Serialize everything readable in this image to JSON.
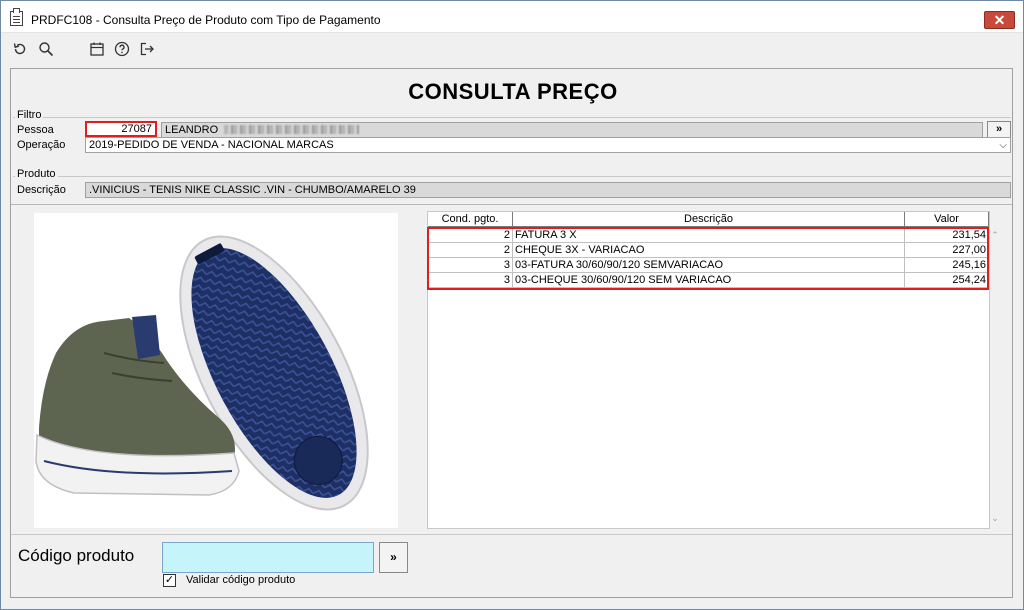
{
  "window": {
    "title": "PRDFC108 - Consulta Preço de Produto com Tipo de Pagamento",
    "close_label": "✕"
  },
  "toolbar": {
    "icons": [
      "refresh-icon",
      "search-icon",
      "calendar-icon",
      "help-icon",
      "exit-icon"
    ]
  },
  "page": {
    "title": "CONSULTA PREÇO"
  },
  "filtro": {
    "group_label": "Filtro",
    "pessoa_label": "Pessoa",
    "pessoa_code": "27087",
    "pessoa_name": "LEANDRO",
    "pessoa_btn": "»",
    "operacao_label": "Operação",
    "operacao_value": "2019-PEDIDO DE VENDA - NACIONAL MARCAS"
  },
  "produto": {
    "group_label": "Produto",
    "descricao_label": "Descrição",
    "descricao_value": ".VINICIUS - TENIS NIKE CLASSIC .VIN - CHUMBO/AMARELO 39"
  },
  "grid": {
    "headers": [
      "Cond. pgto.",
      "Descrição",
      "Valor"
    ],
    "rows": [
      {
        "cond": "2",
        "descricao": "FATURA 3 X",
        "valor": "231,54"
      },
      {
        "cond": "2",
        "descricao": "CHEQUE 3X - VARIACAO",
        "valor": "227,00"
      },
      {
        "cond": "3",
        "descricao": "03-FATURA 30/60/90/120 SEMVARIACAO",
        "valor": "245,16"
      },
      {
        "cond": "3",
        "descricao": "03-CHEQUE 30/60/90/120 SEM VARIACAO",
        "valor": "254,24"
      }
    ]
  },
  "bottom": {
    "codigo_label": "Código produto",
    "codigo_value": "",
    "codigo_btn": "»",
    "validar_label": "Validar código produto",
    "validar_checked": true
  },
  "colors": {
    "highlight_red": "#e01e1e",
    "input_cyan": "#c5f5fb",
    "close_red": "#c94a3a"
  }
}
